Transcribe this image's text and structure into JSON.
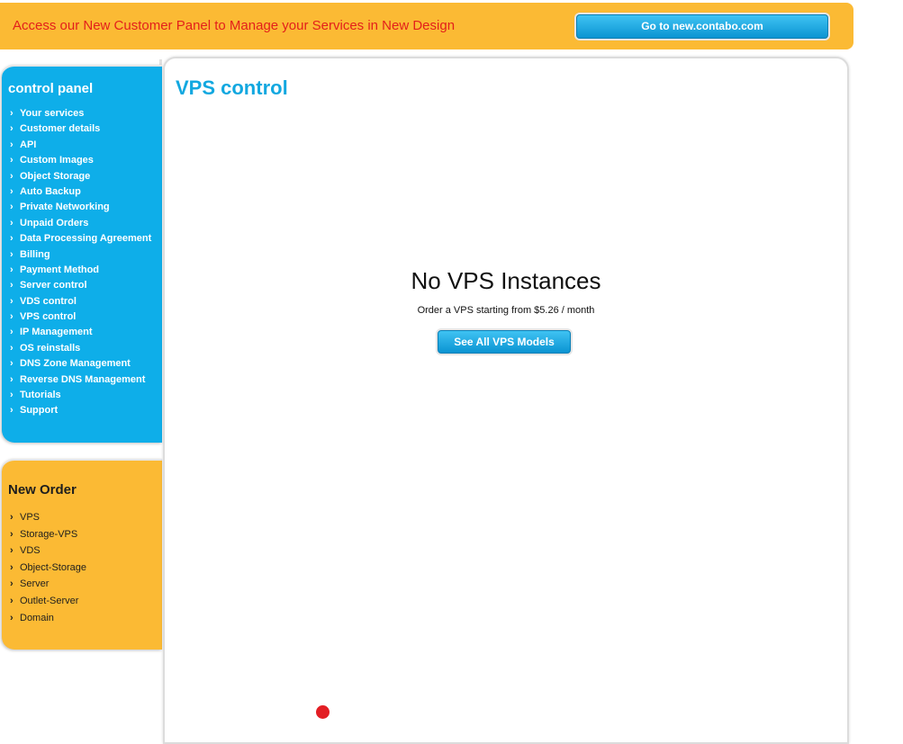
{
  "banner": {
    "text": "Access our New Customer Panel to Manage your Services in New Design",
    "button_label": "Go to new.contabo.com"
  },
  "control_panel": {
    "title": "control panel",
    "items": [
      "Your services",
      "Customer details",
      "API",
      "Custom Images",
      "Object Storage",
      "Auto Backup",
      "Private Networking",
      "Unpaid Orders",
      "Data Processing Agreement",
      "Billing",
      "Payment Method",
      "Server control",
      "VDS control",
      "VPS control",
      "IP Management",
      "OS reinstalls",
      "DNS Zone Management",
      "Reverse DNS Management",
      "Tutorials",
      "Support"
    ]
  },
  "new_order": {
    "title": "New Order",
    "items": [
      "VPS",
      "Storage-VPS",
      "VDS",
      "Object-Storage",
      "Server",
      "Outlet-Server",
      "Domain"
    ]
  },
  "main": {
    "title": "VPS control",
    "empty_title": "No VPS Instances",
    "empty_subtitle": "Order a VPS starting from $5.26 / month",
    "button_label": "See All VPS Models"
  },
  "icons": {
    "list_bullet": "chevron-right-icon"
  },
  "colors": {
    "banner_bg": "#fbba34",
    "banner_text": "#e3201b",
    "control_panel_bg": "#0eaee9",
    "new_order_bg": "#fbba34",
    "title_blue": "#12a8e0",
    "button_blue": "#0b94d2",
    "dot_red": "#e31e24"
  }
}
